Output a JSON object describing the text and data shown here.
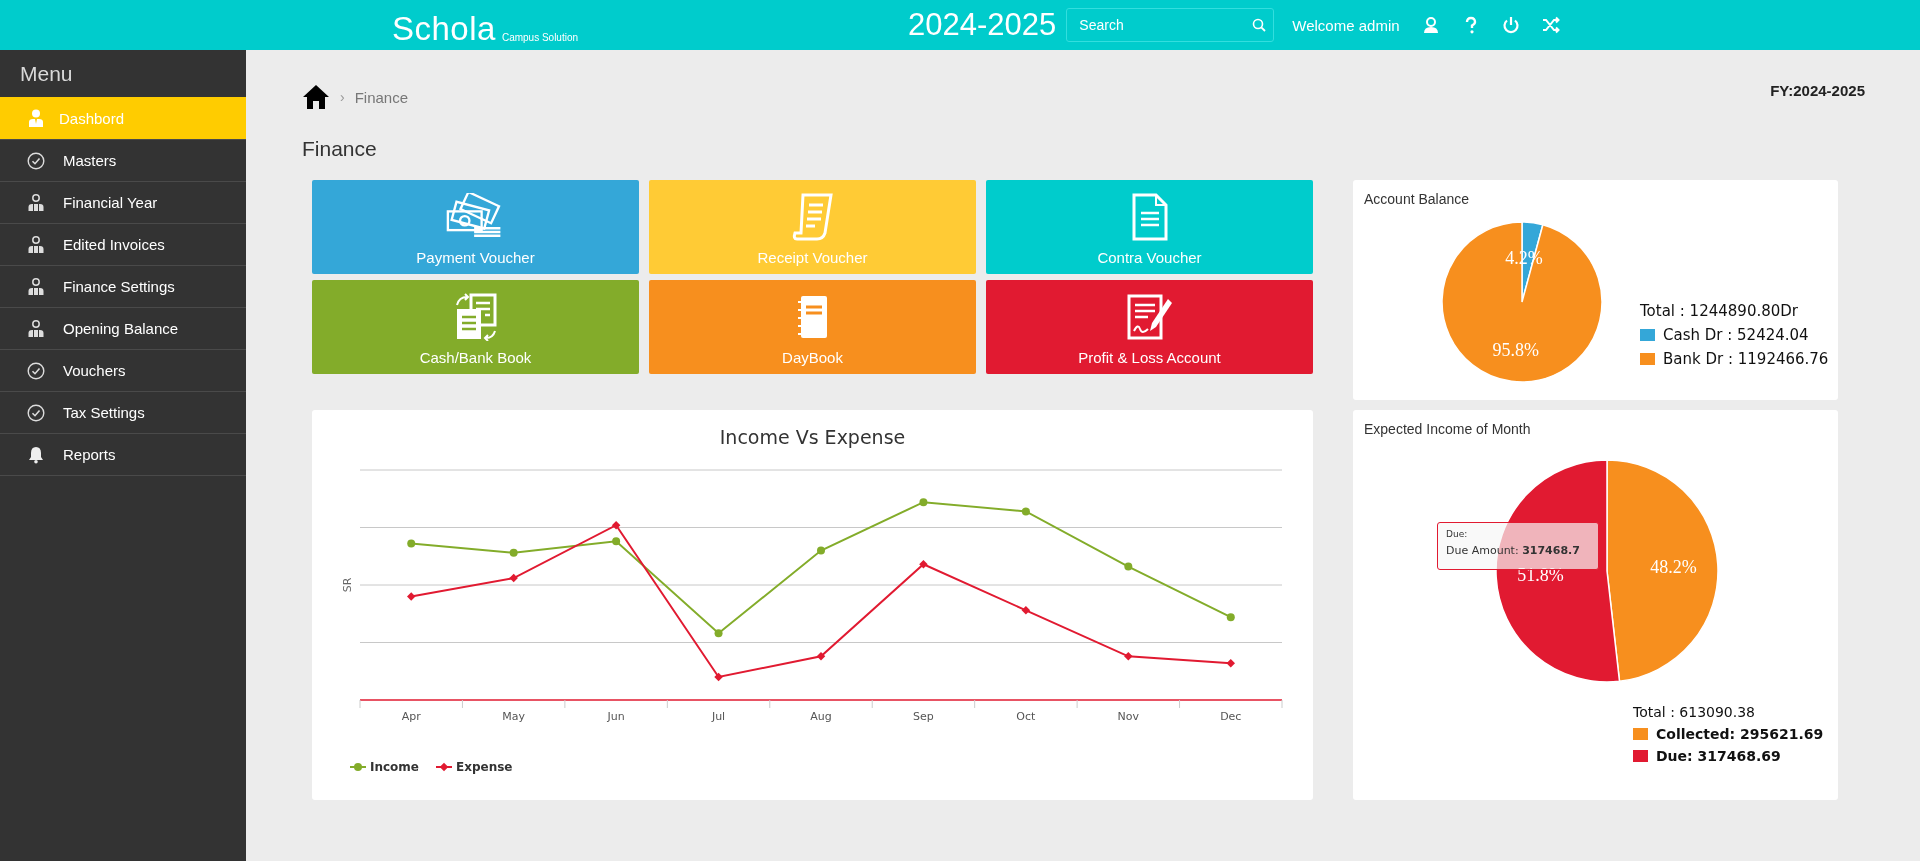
{
  "header": {
    "logo": "Schola",
    "logo_tagline": "Campus Solution",
    "year": "2024-2025",
    "search": {
      "placeholder": "Search"
    },
    "welcome": "Welcome admin"
  },
  "sidebar": {
    "title": "Menu",
    "items": [
      {
        "label": "Dashbord",
        "kind": "person",
        "selected": true
      },
      {
        "label": "Masters",
        "kind": "check",
        "selected": false
      },
      {
        "label": "Financial Year",
        "kind": "people",
        "selected": false
      },
      {
        "label": "Edited Invoices",
        "kind": "people",
        "selected": false
      },
      {
        "label": "Finance Settings",
        "kind": "people",
        "selected": false
      },
      {
        "label": "Opening Balance",
        "kind": "people",
        "selected": false
      },
      {
        "label": "Vouchers",
        "kind": "check",
        "selected": false
      },
      {
        "label": "Tax Settings",
        "kind": "check",
        "selected": false
      },
      {
        "label": "Reports",
        "kind": "bell",
        "selected": false
      }
    ]
  },
  "breadcrumb": {
    "separator": "›",
    "current": "Finance"
  },
  "fiscal_year": "FY:2024-2025",
  "page_title": "Finance",
  "tiles": [
    {
      "label": "Payment Voucher",
      "kind": "money",
      "color": "#34a7d8"
    },
    {
      "label": "Receipt Voucher",
      "kind": "receipt",
      "color": "#ffcb35"
    },
    {
      "label": "Contra Voucher",
      "kind": "document",
      "color": "#00cccc"
    },
    {
      "label": "Cash/Bank Book",
      "kind": "exchange",
      "color": "#83ac2a"
    },
    {
      "label": "DayBook",
      "kind": "notebook",
      "color": "#f78f1e"
    },
    {
      "label": "Profit & Loss Account",
      "kind": "signed",
      "color": "#e11a31"
    }
  ],
  "income_chart": {
    "title": "Income Vs Expense",
    "ylabel": "SR",
    "x_labels": [
      "Apr",
      "May",
      "Jun",
      "Jul",
      "Aug",
      "Sep",
      "Oct",
      "Nov",
      "Dec"
    ],
    "legend": [
      {
        "name": "Income",
        "color": "#83ac2a"
      },
      {
        "name": "Expense",
        "color": "#e11a31"
      }
    ]
  },
  "account_balance": {
    "title": "Account Balance",
    "total": "Total : 1244890.80Dr",
    "legend": [
      {
        "label": "Cash Dr : 52424.04",
        "color": "#34a7d8"
      },
      {
        "label": "Bank Dr : 1192466.76",
        "color": "#f78f1e"
      }
    ],
    "chart_data": {
      "type": "pie",
      "values": [
        4.2,
        95.8
      ],
      "value_labels": [
        "4.2%",
        "95.8%"
      ]
    }
  },
  "expected_income": {
    "title": "Expected Income of Month",
    "total": "Total : 613090.38",
    "legend": [
      {
        "label": "Collected: 295621.69",
        "color": "#f78f1e"
      },
      {
        "label": "Due: 317468.69",
        "color": "#e11a31"
      }
    ],
    "chart_data": {
      "type": "pie",
      "values": [
        48.2,
        51.8
      ],
      "value_labels": [
        "48.2%",
        "51.8%"
      ]
    },
    "tooltip": {
      "title": "Due:",
      "text": "Due Amount: **317468.7**"
    }
  }
}
